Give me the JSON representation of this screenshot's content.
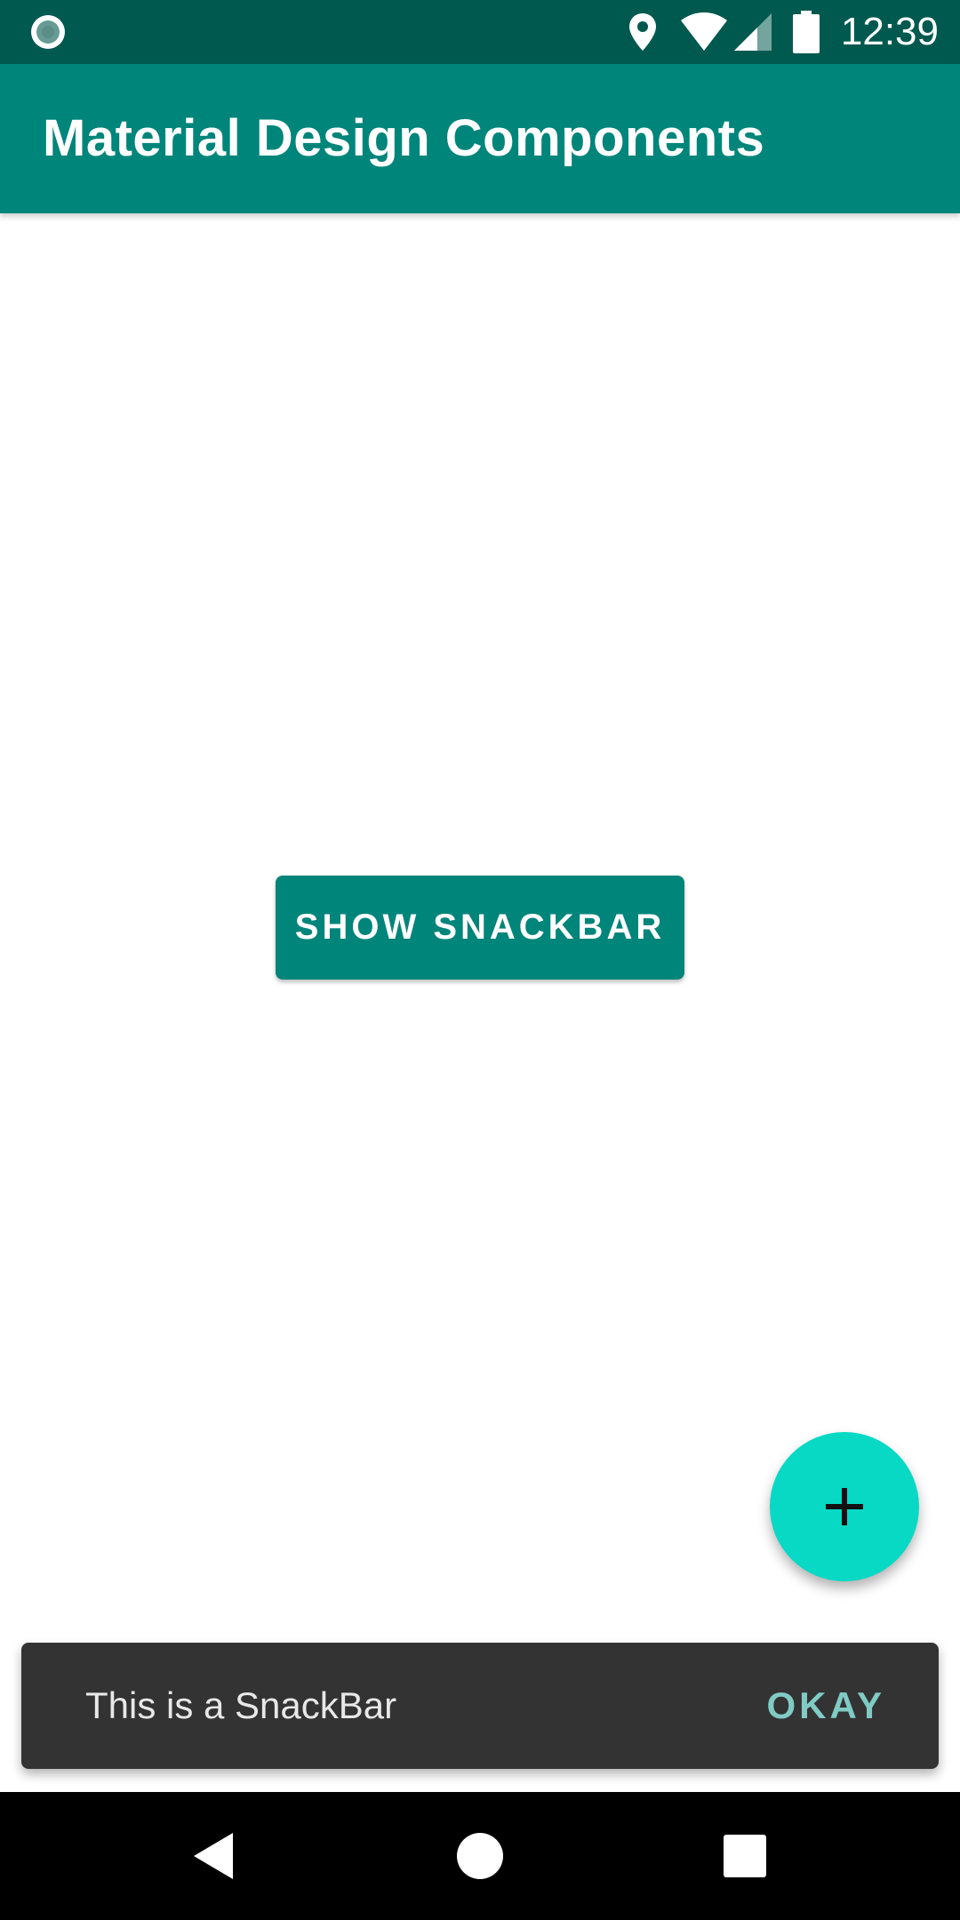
{
  "status_bar": {
    "time": "12:39",
    "icons": [
      "notification-dot-icon",
      "location-icon",
      "wifi-icon",
      "signal-icon",
      "battery-icon"
    ],
    "background": "#00594f"
  },
  "app_bar": {
    "title": "Material Design Components",
    "background": "#00857a"
  },
  "main": {
    "show_snackbar_label": "SHOW SNACKBAR",
    "button_color": "#00857a"
  },
  "fab": {
    "icon": "plus-icon",
    "color": "#07d9c5"
  },
  "snackbar": {
    "message": "This is a SnackBar",
    "action_label": "OKAY",
    "action_color": "#80cbc4",
    "background": "#333333"
  },
  "nav_bar": {
    "buttons": [
      "back-icon",
      "home-icon",
      "recents-icon"
    ]
  }
}
